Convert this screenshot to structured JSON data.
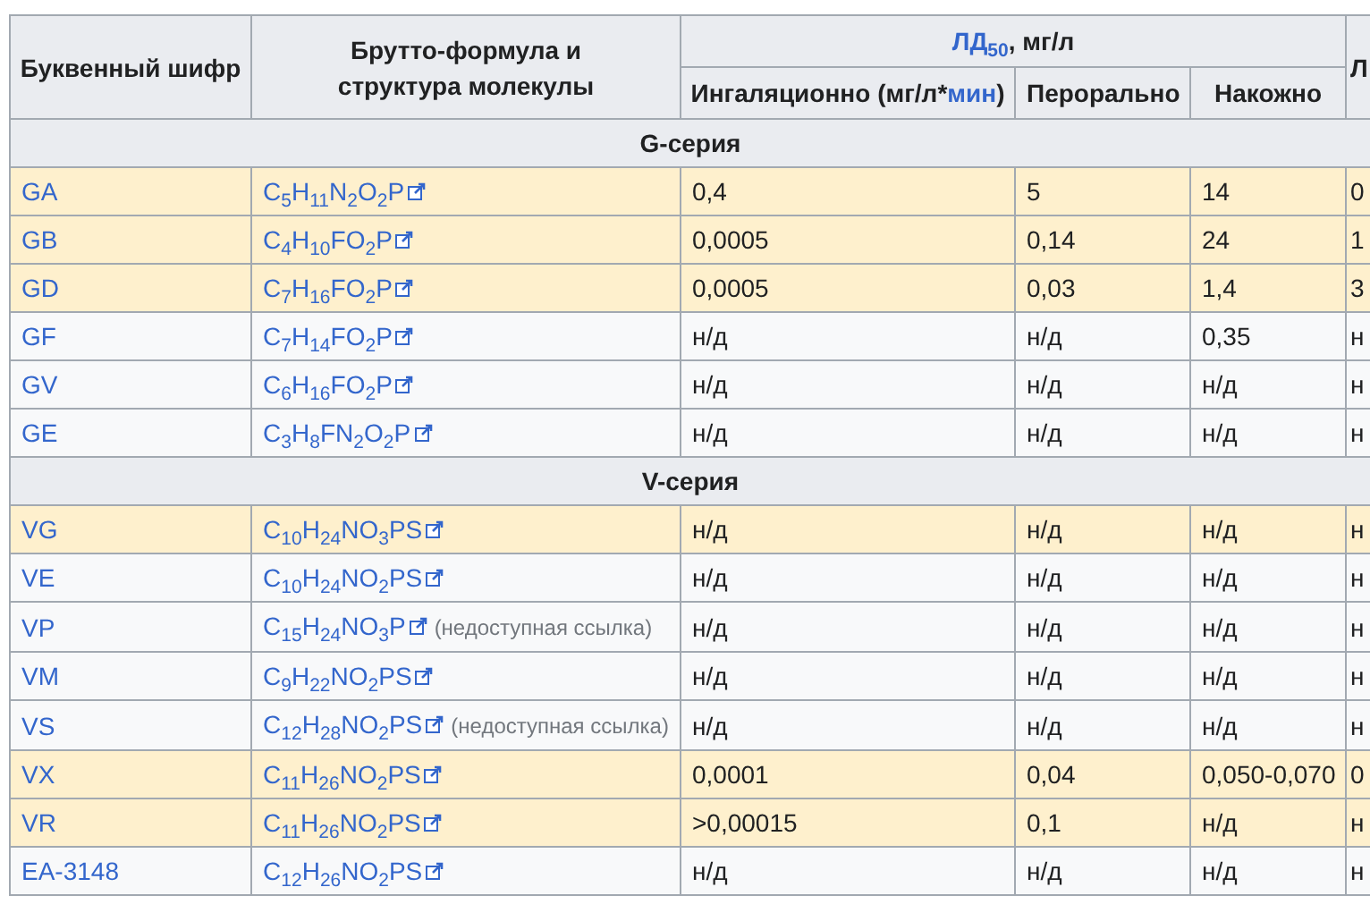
{
  "table": {
    "columns": [
      {
        "label": "Буквенный шифр"
      },
      {
        "label": "Брутто-формула и структура молекулы"
      }
    ],
    "ld50_header": {
      "link": "ЛД$_{50}$",
      "text": ", мг/л"
    },
    "subcolumns": [
      {
        "label": "Ингаляционно (мг/л*",
        "link": "мин",
        "suffix": ")"
      },
      {
        "label": "Перорально"
      },
      {
        "label": "Накожно"
      }
    ],
    "column_5": {
      "label": "Л"
    },
    "sections": [
      {
        "title": "G-серия",
        "rows": [
          {
            "code": "GA",
            "formula": "C$_{5}$H$_{11}$N$_{2}$O$_{2}$P",
            "inhalation": "0,4",
            "oral": "5",
            "dermal": "14",
            "column_5": "0",
            "highlighted": true
          },
          {
            "code": "GB",
            "formula": "C$_{4}$H$_{10}$FO$_{2}$P",
            "inhalation": "0,0005",
            "oral": "0,14",
            "dermal": "24",
            "column_5": "1",
            "highlighted": true
          },
          {
            "code": "GD",
            "formula": "C$_{7}$H$_{16}$FO$_{2}$P",
            "inhalation": "0,0005",
            "oral": "0,03",
            "dermal": "1,4",
            "column_5": "3",
            "highlighted": true
          },
          {
            "code": "GF",
            "formula": "C$_{7}$H$_{14}$FO$_{2}$P",
            "inhalation": "н/д",
            "oral": "н/д",
            "dermal": "0,35",
            "column_5": "н",
            "highlighted": false
          },
          {
            "code": "GV",
            "formula": "C$_{6}$H$_{16}$FO$_{2}$P",
            "inhalation": "н/д",
            "oral": "н/д",
            "dermal": "н/д",
            "column_5": "н",
            "highlighted": false
          },
          {
            "code": "GE",
            "formula": "C$_{3}$H$_{8}$FN$_{2}$O$_{2}$P",
            "inhalation": "н/д",
            "oral": "н/д",
            "dermal": "н/д",
            "column_5": "н",
            "highlighted": false
          }
        ]
      },
      {
        "title": "V-серия",
        "rows": [
          {
            "code": "VG",
            "formula": "C$_{10}$H$_{24}$NO$_{3}$PS",
            "inhalation": "н/д",
            "oral": "н/д",
            "dermal": "н/д",
            "column_5": "н",
            "highlighted": true
          },
          {
            "code": "VE",
            "formula": "C$_{10}$H$_{24}$NO$_{2}$PS",
            "inhalation": "н/д",
            "oral": "н/д",
            "dermal": "н/д",
            "column_5": "н",
            "highlighted": false
          },
          {
            "code": "VP",
            "formula": "C$_{15}$H$_{24}$NO$_{3}$P",
            "note": "(недоступная ссылка)",
            "inhalation": "н/д",
            "oral": "н/д",
            "dermal": "н/д",
            "column_5": "н",
            "highlighted": false
          },
          {
            "code": "VM",
            "formula": "C$_{9}$H$_{22}$NO$_{2}$PS",
            "inhalation": "н/д",
            "oral": "н/д",
            "dermal": "н/д",
            "column_5": "н",
            "highlighted": false
          },
          {
            "code": "VS",
            "formula": "C$_{12}$H$_{28}$NO$_{2}$PS",
            "note": "(недоступная ссылка)",
            "inhalation": "н/д",
            "oral": "н/д",
            "dermal": "н/д",
            "column_5": "н",
            "highlighted": false
          },
          {
            "code": "VX",
            "formula": "C$_{11}$H$_{26}$NO$_{2}$PS",
            "inhalation": "0,0001",
            "oral": "0,04",
            "dermal": "0,050-0,070",
            "column_5": "0",
            "highlighted": true
          },
          {
            "code": "VR",
            "formula": "C$_{11}$H$_{26}$NO$_{2}$PS",
            "inhalation": ">0,00015",
            "oral": "0,1",
            "dermal": "н/д",
            "column_5": "н",
            "highlighted": true
          },
          {
            "code": "EA-3148",
            "formula": "C$_{12}$H$_{26}$NO$_{2}$PS",
            "inhalation": "н/д",
            "oral": "н/д",
            "dermal": "н/д",
            "column_5": "н",
            "highlighted": false
          }
        ]
      }
    ]
  }
}
